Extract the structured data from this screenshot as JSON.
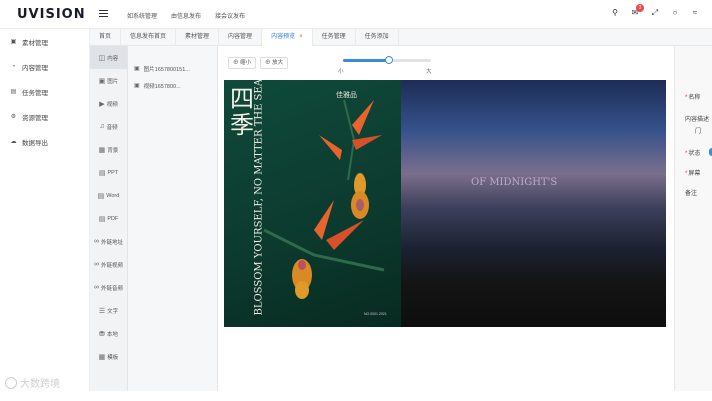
{
  "app": {
    "logo_text": "UVISION",
    "top_nav": [
      "如系统管理",
      "由信息发布",
      "接会议发布"
    ],
    "notification_count": "3"
  },
  "sidebar": {
    "items": [
      {
        "icon": "display-icon",
        "label": "素材管理"
      },
      {
        "icon": "dashboard-icon",
        "label": "内容管理"
      },
      {
        "icon": "task-icon",
        "label": "任务管理"
      },
      {
        "icon": "settings-icon",
        "label": "资源管理"
      },
      {
        "icon": "cloud-icon",
        "label": "数据导出"
      }
    ]
  },
  "tabs": [
    {
      "label": "首页",
      "active": false
    },
    {
      "label": "信息发布首页",
      "active": false
    },
    {
      "label": "素材管理",
      "active": false
    },
    {
      "label": "内容管理",
      "active": false
    },
    {
      "label": "内容预览",
      "active": true,
      "closable": true
    },
    {
      "label": "任务管理",
      "active": false
    },
    {
      "label": "任务添加",
      "active": false
    }
  ],
  "types": [
    {
      "label": "内容",
      "icon": "layers-icon",
      "active": true
    },
    {
      "label": "图片",
      "icon": "image-icon"
    },
    {
      "label": "视频",
      "icon": "video-icon"
    },
    {
      "label": "音频",
      "icon": "audio-icon"
    },
    {
      "label": "背景",
      "icon": "background-icon"
    },
    {
      "label": "PPT",
      "icon": "ppt-icon"
    },
    {
      "label": "Word",
      "icon": "word-icon"
    },
    {
      "label": "PDF",
      "icon": "pdf-icon"
    },
    {
      "label": "外链地址",
      "icon": "link-icon"
    },
    {
      "label": "外链视频",
      "icon": "link-video-icon"
    },
    {
      "label": "外链音频",
      "icon": "link-audio-icon"
    },
    {
      "label": "文字",
      "icon": "text-icon"
    },
    {
      "label": "本地",
      "icon": "database-icon"
    },
    {
      "label": "模板",
      "icon": "grid-icon"
    }
  ],
  "files": [
    {
      "icon": "image-file-icon",
      "name": "图片1657800151..."
    },
    {
      "icon": "image-file-icon",
      "name": "视频1657800..."
    }
  ],
  "zoom": {
    "shrink": "缩小",
    "enlarge": "放大",
    "min_label": "小",
    "max_label": "大",
    "level_fraction": 0.52
  },
  "poster1": {
    "title": "四季",
    "brand": "佳雅品",
    "vertical_text": "BLOSSOM YOURSELF, NO MATTER THE SEASON",
    "caption": "NO.0001.2021"
  },
  "poster2": {
    "title": "OF MIDNIGHT'S"
  },
  "right_panel": {
    "labels": [
      "名称",
      "内容描述",
      "门",
      "状态",
      "屏幕",
      "备注"
    ]
  },
  "watermark": {
    "text": "大数跨境"
  },
  "colors": {
    "accent": "#2f7de1",
    "badge": "#f04848",
    "poster_green": "#0c3a2e"
  }
}
